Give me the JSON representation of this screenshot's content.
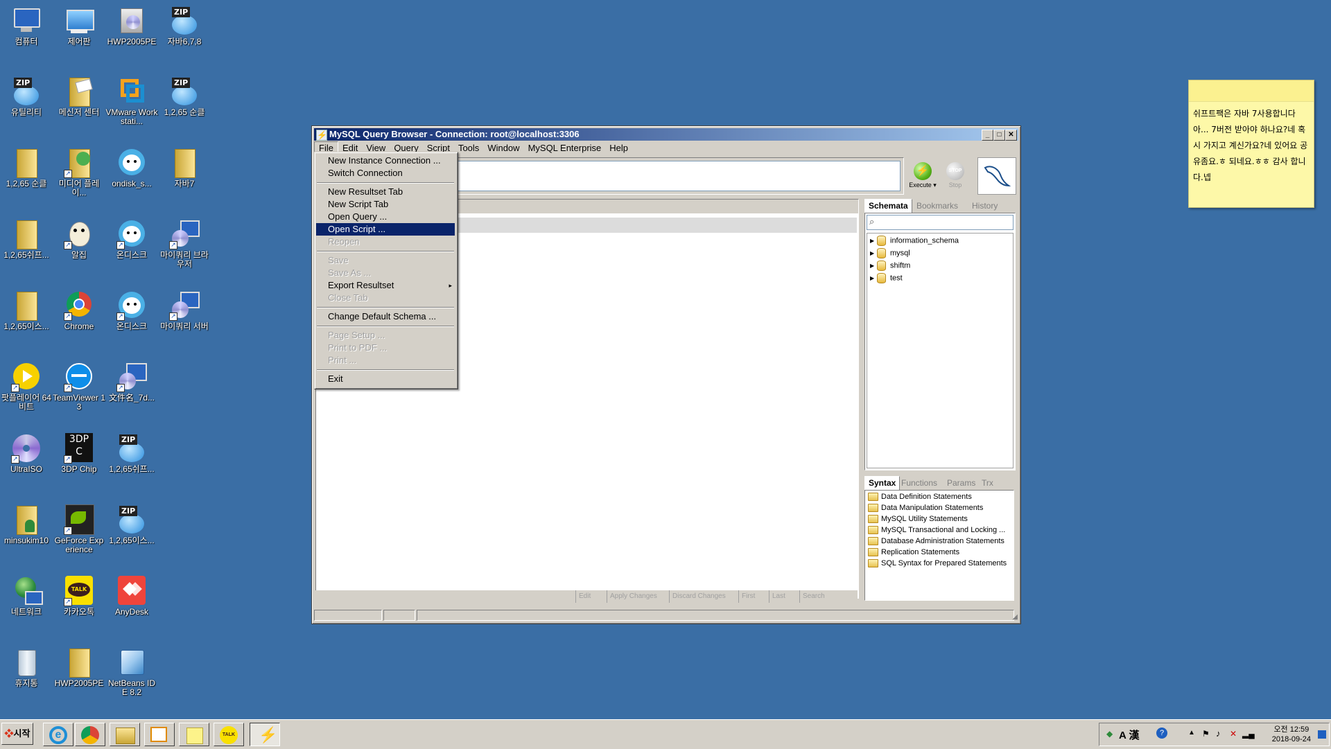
{
  "desktop": {
    "icons": [
      {
        "label": "컴퓨터",
        "icon": "computer-icon"
      },
      {
        "label": "제어판",
        "icon": "control-panel-icon"
      },
      {
        "label": "HWP2005PE",
        "icon": "installer-icon"
      },
      {
        "label": "자바6,7,8",
        "icon": "zip-icon"
      },
      {
        "label": "유틸리티",
        "icon": "zip-icon"
      },
      {
        "label": "메신저 센터",
        "icon": "messenger-icon"
      },
      {
        "label": "VMware Workstati...",
        "icon": "vmware-icon"
      },
      {
        "label": "1,2,65 순클",
        "icon": "zip-icon"
      },
      {
        "label": "1,2,65 순클",
        "icon": "folder-icon"
      },
      {
        "label": "미디어 플레이...",
        "icon": "media-player-icon"
      },
      {
        "label": "ondisk_s...",
        "icon": "ondisk-icon"
      },
      {
        "label": "자바7",
        "icon": "folder-icon"
      },
      {
        "label": "1,2,65쉬프...",
        "icon": "folder-icon"
      },
      {
        "label": "알집",
        "icon": "alzip-icon"
      },
      {
        "label": "온디스크",
        "icon": "ondisk-icon"
      },
      {
        "label": "마이쿼리 브라우저",
        "icon": "mysql-browser-icon"
      },
      {
        "label": "1,2,65이스...",
        "icon": "folder-icon"
      },
      {
        "label": "Chrome",
        "icon": "chrome-icon"
      },
      {
        "label": "온디스크",
        "icon": "ondisk-icon"
      },
      {
        "label": "마이쿼리 서버",
        "icon": "mysql-server-icon"
      },
      {
        "label": "팟플레이어 64 비트",
        "icon": "potplayer-icon"
      },
      {
        "label": "TeamViewer 13",
        "icon": "teamviewer-icon"
      },
      {
        "label": "文件名_7d...",
        "icon": "installer-icon"
      },
      {
        "label": "UltraISO",
        "icon": "ultraiso-icon"
      },
      {
        "label": "3DP Chip",
        "icon": "3dp-chip-icon"
      },
      {
        "label": "1,2,65쉬프...",
        "icon": "zip-icon"
      },
      {
        "label": "minsukim10",
        "icon": "user-folder-icon"
      },
      {
        "label": "GeForce Experience",
        "icon": "geforce-icon"
      },
      {
        "label": "1,2,65이스...",
        "icon": "zip-icon"
      },
      {
        "label": "네트워크",
        "icon": "network-icon"
      },
      {
        "label": "카카오톡",
        "icon": "kakaotalk-icon"
      },
      {
        "label": "AnyDesk",
        "icon": "anydesk-icon"
      },
      {
        "label": "휴지통",
        "icon": "recycle-bin-icon"
      },
      {
        "label": "HWP2005PE",
        "icon": "folder-icon"
      },
      {
        "label": "NetBeans IDE 8.2",
        "icon": "netbeans-icon"
      }
    ],
    "icon_glyphs": {
      "zip": "ZIP",
      "talk": "TALK",
      "chip": "3DP C"
    }
  },
  "sticky_note": {
    "text": "쉬프트팩은 자바 7사용합니다 아... 7버전 받아야 하나요?네 혹시 가지고 계신가요?네 있어요 공유좀요.ㅎ 되네요.ㅎㅎ 감사 합니다.넵"
  },
  "window": {
    "title": "MySQL Query Browser - Connection: root@localhost:3306",
    "menu": [
      "File",
      "Edit",
      "View",
      "Query",
      "Script",
      "Tools",
      "Window",
      "MySQL Enterprise",
      "Help"
    ],
    "controls": {
      "minimize": "_",
      "maximize": "□",
      "close": "✕"
    },
    "execute_label": "Execute ▾",
    "stop_label": "Stop",
    "stop_ball_text": "STOP",
    "result_toolbar": [
      "Edit",
      "Apply Changes",
      "Discard Changes",
      "First",
      "Last",
      "Search"
    ],
    "schemata_tabs": [
      "Schemata",
      "Bookmarks",
      "History"
    ],
    "schemata": [
      "information_schema",
      "mysql",
      "shiftm",
      "test"
    ],
    "syntax_tabs": [
      "Syntax",
      "Functions",
      "Params",
      "Trx"
    ],
    "syntax_items": [
      "Data Definition Statements",
      "Data Manipulation Statements",
      "MySQL Utility Statements",
      "MySQL Transactional and Locking ...",
      "Database Administration Statements",
      "Replication Statements",
      "SQL Syntax for Prepared Statements"
    ]
  },
  "file_menu": {
    "items": [
      {
        "label": "New Instance Connection ...",
        "state": "normal"
      },
      {
        "label": "Switch Connection",
        "state": "normal"
      },
      {
        "label": "New Resultset Tab",
        "state": "normal"
      },
      {
        "label": "New Script Tab",
        "state": "normal"
      },
      {
        "label": "Open Query ...",
        "state": "normal"
      },
      {
        "label": "Open Script ...",
        "state": "highlighted"
      },
      {
        "label": "Reopen",
        "state": "disabled"
      },
      {
        "label": "Save",
        "state": "disabled"
      },
      {
        "label": "Save As ...",
        "state": "disabled"
      },
      {
        "label": "Export Resultset",
        "state": "normal",
        "submenu": "▸"
      },
      {
        "label": "Close Tab",
        "state": "disabled"
      },
      {
        "label": "Change Default Schema ...",
        "state": "normal"
      },
      {
        "label": "Page Setup ...",
        "state": "disabled"
      },
      {
        "label": "Print to PDF ...",
        "state": "disabled"
      },
      {
        "label": "Print ...",
        "state": "disabled"
      },
      {
        "label": "Exit",
        "state": "normal"
      }
    ]
  },
  "taskbar": {
    "start_label": "시작",
    "apps": [
      "internet-explorer-icon",
      "chrome-icon",
      "explorer-icon",
      "media-player-icon",
      "sticky-notes-icon",
      "kakaotalk-icon",
      "mysql-query-browser-icon"
    ],
    "tray_ime": "A 漢",
    "clock_time": "오전 12:59",
    "clock_date": "2018-09-24"
  }
}
